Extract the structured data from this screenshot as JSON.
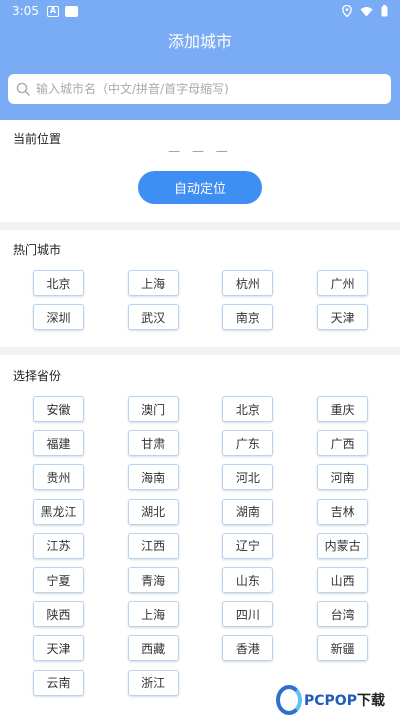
{
  "status_bar": {
    "time": "3:05",
    "badges": [
      "A",
      "▭"
    ],
    "icons": [
      "location-icon",
      "wifi-icon",
      "battery-icon"
    ]
  },
  "header": {
    "title": "添加城市",
    "background": "#7aabf5"
  },
  "search": {
    "placeholder": "输入城市名（中文/拼音/首字母缩写)",
    "value": ""
  },
  "current_location": {
    "label": "当前位置",
    "value": "— — —",
    "button_label": "自动定位",
    "button_color": "#3f8ef4"
  },
  "hot_cities": {
    "label": "热门城市",
    "items": [
      "北京",
      "上海",
      "杭州",
      "广州",
      "深圳",
      "武汉",
      "南京",
      "天津"
    ]
  },
  "provinces": {
    "label": "选择省份",
    "items": [
      "安徽",
      "澳门",
      "北京",
      "重庆",
      "福建",
      "甘肃",
      "广东",
      "广西",
      "贵州",
      "海南",
      "河北",
      "河南",
      "黑龙江",
      "湖北",
      "湖南",
      "吉林",
      "江苏",
      "江西",
      "辽宁",
      "内蒙古",
      "宁夏",
      "青海",
      "山东",
      "山西",
      "陕西",
      "上海",
      "四川",
      "台湾",
      "天津",
      "西藏",
      "香港",
      "新疆",
      "云南",
      "浙江"
    ]
  },
  "watermark": {
    "brand": "PCPOP",
    "suffix": "下载"
  }
}
